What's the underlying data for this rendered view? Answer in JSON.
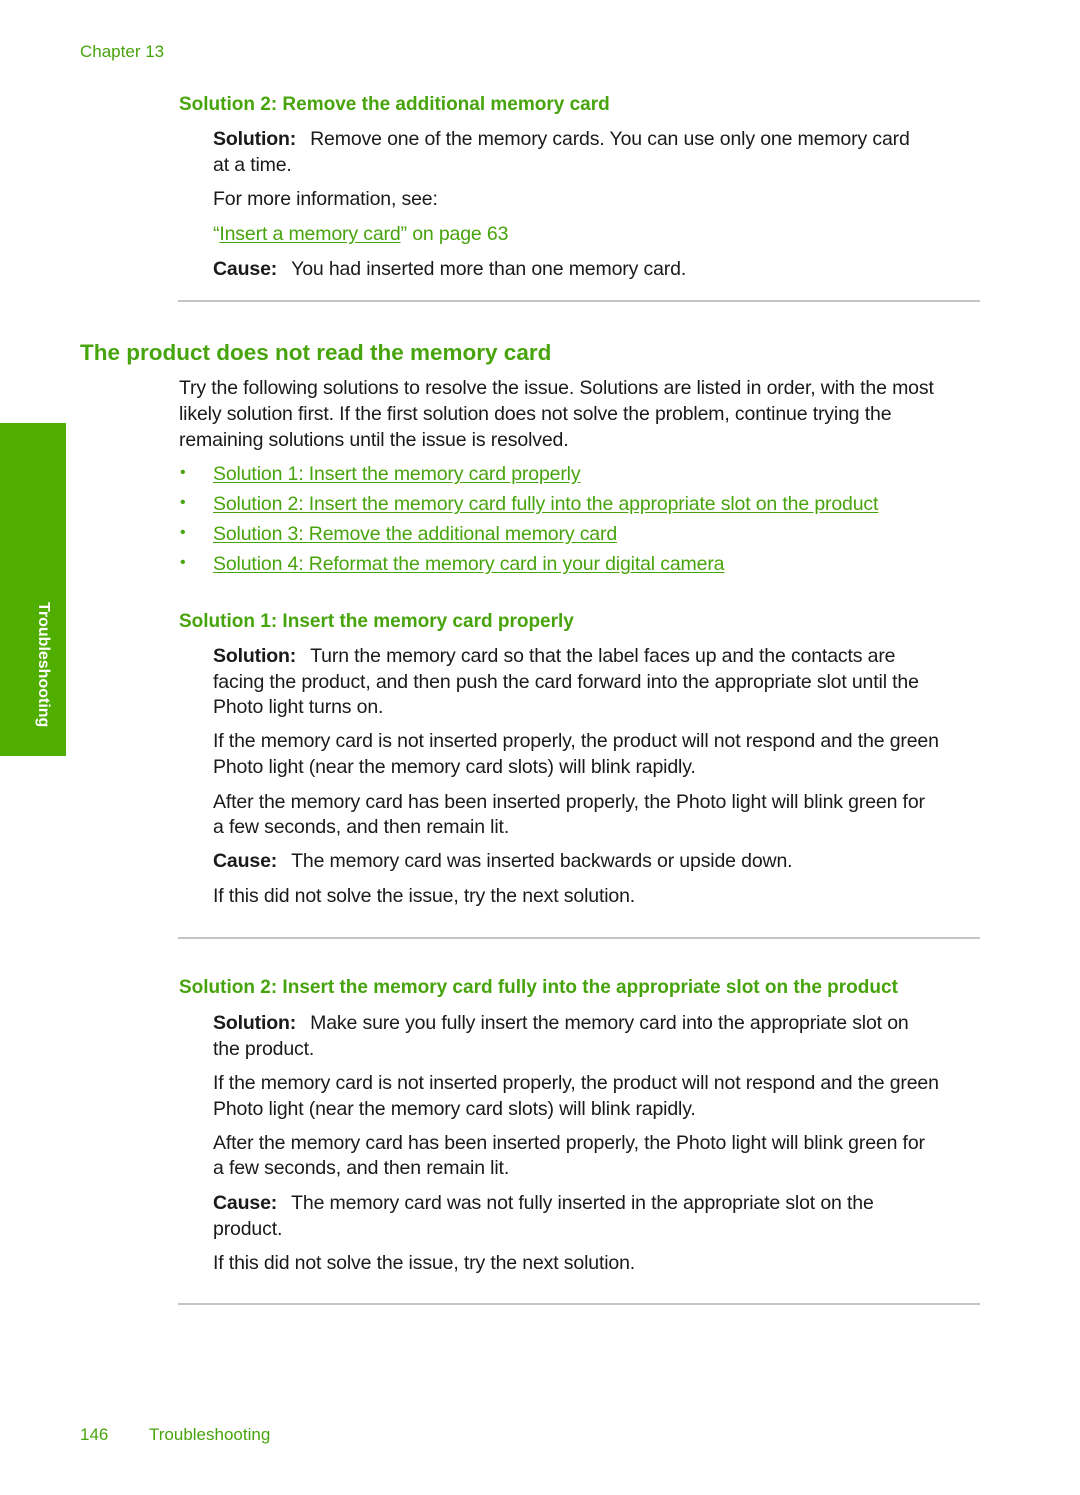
{
  "header": {
    "chapter": "Chapter 13"
  },
  "side_tab": {
    "label": "Troubleshooting",
    "color": "#4fae00"
  },
  "accent_color": "#47a40c",
  "prev_section": {
    "heading": "Solution 2: Remove the additional memory card",
    "solution_label": "Solution:",
    "solution_line1": "Remove one of the memory cards. You can use only one memory card",
    "solution_line2": "at a time.",
    "more_info": "For more information, see:",
    "xref_open_quote": "“",
    "xref_link": "Insert a memory card",
    "xref_rest": "” on page 63",
    "cause_label": "Cause:",
    "cause_text": "You had inserted more than one memory card."
  },
  "section": {
    "title": "The product does not read the memory card",
    "intro_lines": [
      "Try the following solutions to resolve the issue. Solutions are listed in order, with the most",
      "likely solution first. If the first solution does not solve the problem, continue trying the",
      "remaining solutions until the issue is resolved."
    ],
    "bullet_char": "•",
    "links": [
      "Solution 1: Insert the memory card properly",
      "Solution 2: Insert the memory card fully into the appropriate slot on the product",
      "Solution 3: Remove the additional memory card",
      "Solution 4: Reformat the memory card in your digital camera"
    ]
  },
  "solution1": {
    "heading": "Solution 1: Insert the memory card properly",
    "solution_label": "Solution:",
    "solution_lines": [
      "Turn the memory card so that the label faces up and the contacts are",
      "facing the product, and then push the card forward into the appropriate slot until the",
      "Photo light turns on."
    ],
    "para2": [
      "If the memory card is not inserted properly, the product will not respond and the green",
      "Photo light (near the memory card slots) will blink rapidly."
    ],
    "para3": [
      "After the memory card has been inserted properly, the Photo light will blink green for",
      "a few seconds, and then remain lit."
    ],
    "cause_label": "Cause:",
    "cause_text": "The memory card was inserted backwards or upside down.",
    "next": "If this did not solve the issue, try the next solution."
  },
  "solution2": {
    "heading": "Solution 2: Insert the memory card fully into the appropriate slot on the product",
    "solution_label": "Solution:",
    "solution_lines": [
      "Make sure you fully insert the memory card into the appropriate slot on",
      "the product."
    ],
    "para2": [
      "If the memory card is not inserted properly, the product will not respond and the green",
      "Photo light (near the memory card slots) will blink rapidly."
    ],
    "para3": [
      "After the memory card has been inserted properly, the Photo light will blink green for",
      "a few seconds, and then remain lit."
    ],
    "cause_label": "Cause:",
    "cause_lines": [
      "The memory card was not fully inserted in the appropriate slot on the",
      "product."
    ],
    "next": "If this did not solve the issue, try the next solution."
  },
  "footer": {
    "page_number": "146",
    "section": "Troubleshooting"
  }
}
